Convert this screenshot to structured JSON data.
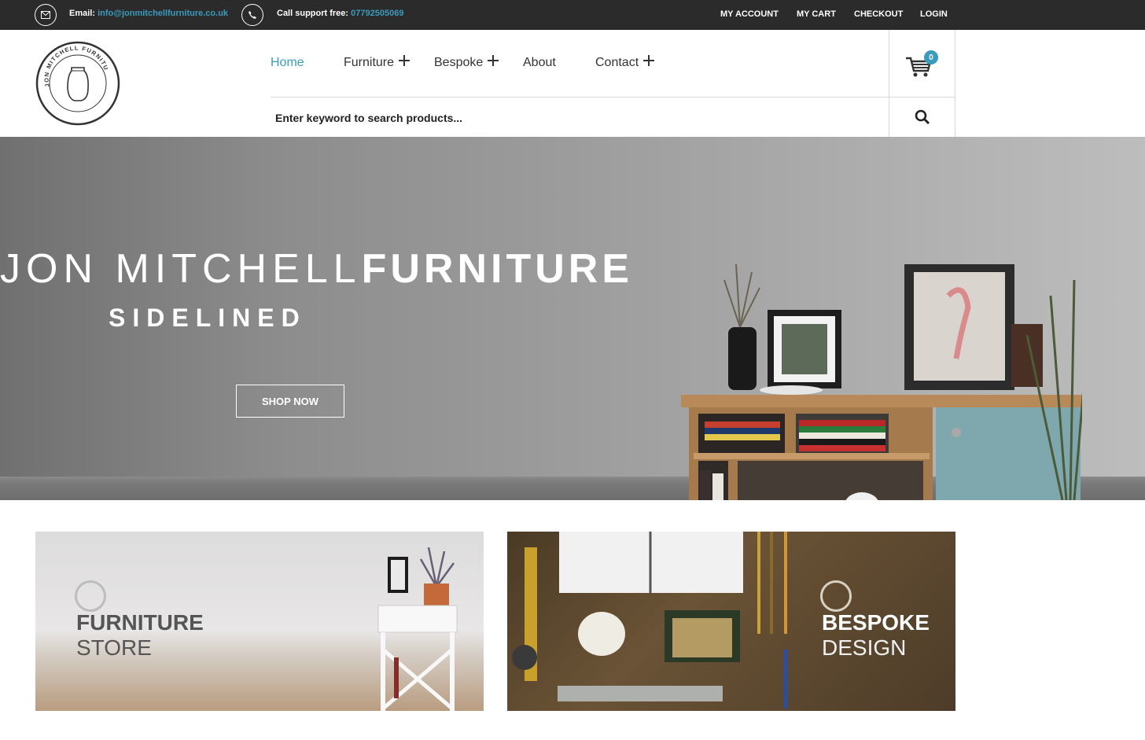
{
  "topbar": {
    "email_label": "Email:",
    "email_value": "info@jonmitchellfurniture.co.uk",
    "phone_label": "Call support free:",
    "phone_value": "07792505069",
    "links": [
      "MY ACCOUNT",
      "MY CART",
      "CHECKOUT",
      "LOGIN"
    ]
  },
  "header": {
    "nav": [
      {
        "label": "Home",
        "active": true
      },
      {
        "label": "Furniture",
        "has_submenu": true
      },
      {
        "label": "Bespoke",
        "has_submenu": true
      },
      {
        "label": "About"
      },
      {
        "label": "Contact",
        "has_submenu": true
      }
    ],
    "search_placeholder": "Enter keyword to search products...",
    "cart_count": "0"
  },
  "hero": {
    "title_light": "JON MITCHELL",
    "title_bold": "FURNITURE",
    "subtitle": "SIDELINED",
    "cta": "SHOP NOW"
  },
  "promos": [
    {
      "title": "FURNITURE",
      "subtitle": "STORE"
    },
    {
      "title": "BESPOKE",
      "subtitle": "DESIGN"
    }
  ],
  "colors": {
    "accent": "#3a9bbd",
    "topbar": "#2b2b2b"
  }
}
